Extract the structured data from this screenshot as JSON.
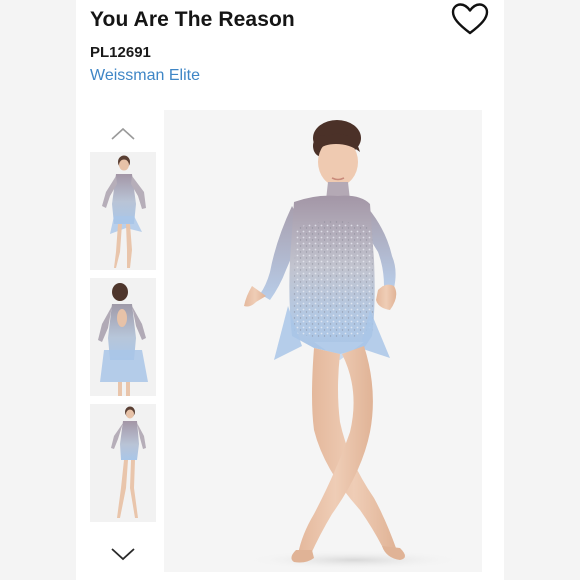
{
  "product": {
    "title": "You Are The Reason",
    "sku": "PL12691",
    "brand": "Weissman Elite"
  },
  "icons": {
    "favorite": "heart-outline-icon",
    "gallery_prev": "chevron-up-icon",
    "gallery_next": "chevron-down-icon"
  },
  "colors": {
    "brand_link": "#3f86c6",
    "title_text": "#151515",
    "costume_blue": "#a9c6e8",
    "costume_mauve": "#a396a6"
  },
  "gallery": {
    "thumbnails": [
      {
        "view": "front"
      },
      {
        "view": "back"
      },
      {
        "view": "full-length"
      }
    ],
    "selected_index": 0
  }
}
